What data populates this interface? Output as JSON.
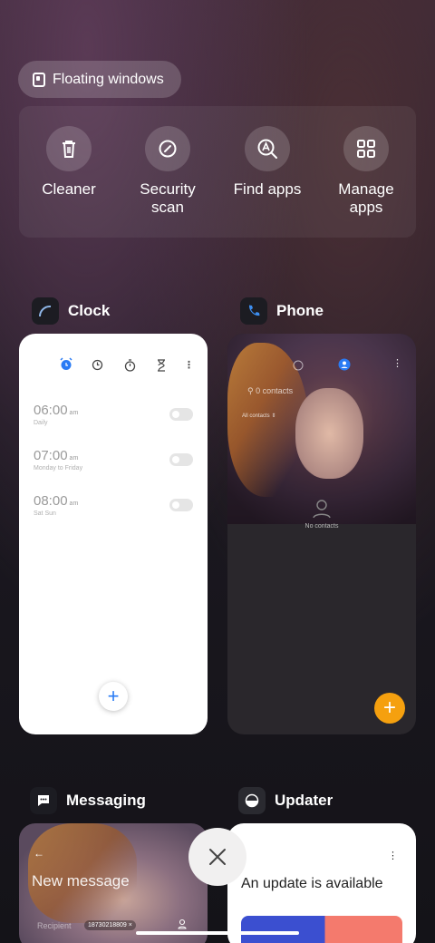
{
  "floating": {
    "label": "Floating windows"
  },
  "quick_actions": [
    {
      "label": "Cleaner",
      "icon": "trash-icon"
    },
    {
      "label": "Security\nscan",
      "icon": "security-scan-icon"
    },
    {
      "label": "Find apps",
      "icon": "find-apps-icon"
    },
    {
      "label": "Manage\napps",
      "icon": "grid-icon"
    }
  ],
  "apps": {
    "clock": {
      "name": "Clock",
      "alarms": [
        {
          "time": "06:00",
          "ampm": "am",
          "repeat": "Daily"
        },
        {
          "time": "07:00",
          "ampm": "am",
          "repeat": "Monday to Friday"
        },
        {
          "time": "08:00",
          "ampm": "am",
          "repeat": "Sat Sun"
        }
      ],
      "fab": "+"
    },
    "phone": {
      "name": "Phone",
      "search_placeholder": "0 contacts",
      "filter": "All contacts",
      "empty": "No contacts",
      "fab": "+"
    },
    "messaging": {
      "name": "Messaging",
      "title": "New message",
      "recipient_label": "Recipient",
      "recipient_number": "18730218809"
    },
    "updater": {
      "name": "Updater",
      "message": "An update is available"
    }
  },
  "colors": {
    "phone_fab": "#f5a00f",
    "clock_accent": "#2a7bf4",
    "update_blue": "#3b4fd0",
    "update_coral": "#f47a6d"
  }
}
